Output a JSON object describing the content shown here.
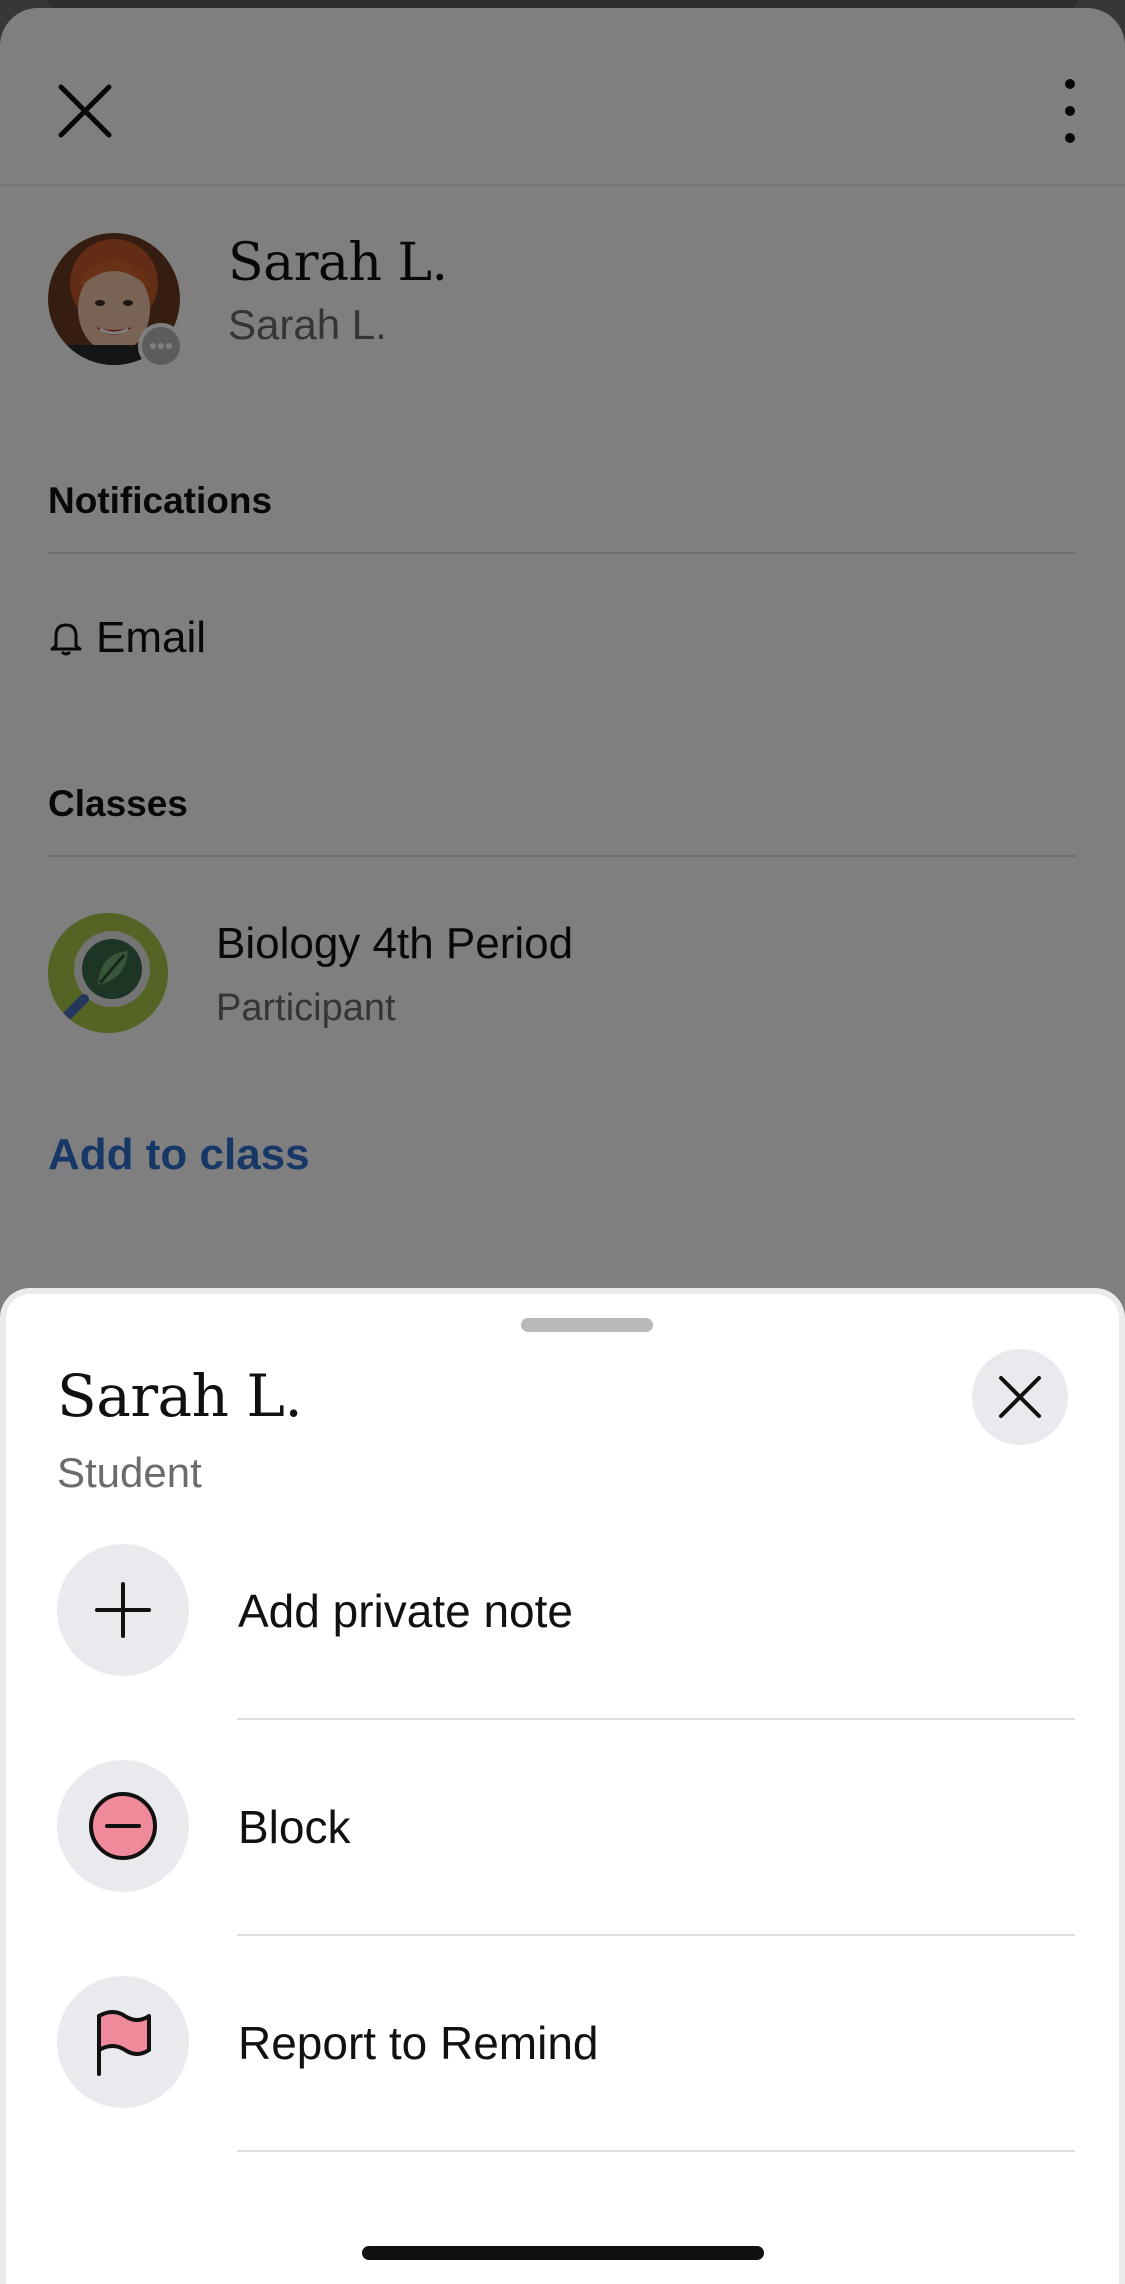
{
  "profile": {
    "name": "Sarah L.",
    "subtitle": "Sarah L.",
    "avatar_icon": "user-photo",
    "badge_icon": "more-dots-icon"
  },
  "header": {
    "close_icon": "close-icon",
    "more_icon": "more-vertical-icon"
  },
  "notifications": {
    "title": "Notifications",
    "items": [
      {
        "icon": "bell-icon",
        "label": "Email"
      }
    ]
  },
  "classes": {
    "title": "Classes",
    "items": [
      {
        "icon": "biology-class-icon",
        "name": "Biology 4th Period",
        "role": "Participant"
      }
    ],
    "add_label": "Add to class"
  },
  "sheet": {
    "title": "Sarah L.",
    "subtitle": "Student",
    "close_icon": "close-icon",
    "actions": [
      {
        "icon": "plus-icon",
        "label": "Add private note"
      },
      {
        "icon": "block-icon",
        "label": "Block"
      },
      {
        "icon": "flag-icon",
        "label": "Report to Remind"
      }
    ]
  },
  "colors": {
    "link": "#2f6fcf",
    "danger_fill": "#ee8a9a",
    "circle_bg": "#e9eaee",
    "overlay": "rgba(0,0,0,0.5)"
  }
}
